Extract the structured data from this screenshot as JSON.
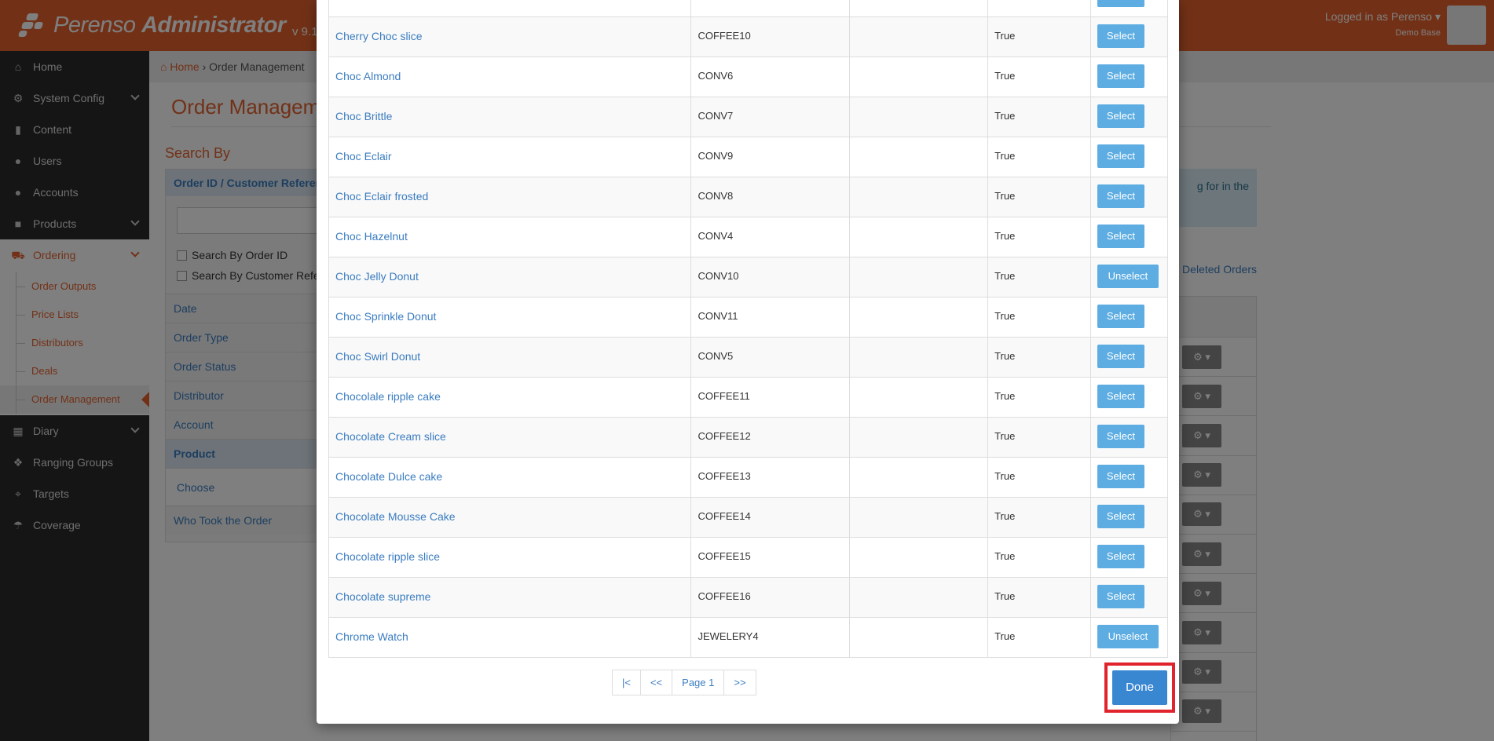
{
  "header": {
    "brand_light": "Perenso ",
    "brand_bold": "Administrator",
    "version": "v 9.1",
    "user": "Logged in as Perenso",
    "user_sub": "Demo Base"
  },
  "sidebar": {
    "items": [
      {
        "label": "Home",
        "icon": "home-icon"
      },
      {
        "label": "System Config",
        "icon": "gear-icon"
      },
      {
        "label": "Content",
        "icon": "file-icon"
      },
      {
        "label": "Users",
        "icon": "user-icon"
      },
      {
        "label": "Accounts",
        "icon": "group-icon"
      },
      {
        "label": "Products",
        "icon": "gift-icon"
      },
      {
        "label": "Ordering",
        "icon": "cart-icon"
      },
      {
        "label": "Diary",
        "icon": "calendar-icon"
      },
      {
        "label": "Ranging Groups",
        "icon": "cubes-icon"
      },
      {
        "label": "Targets",
        "icon": "crosshair-icon"
      },
      {
        "label": "Coverage",
        "icon": "umbrella-icon"
      }
    ],
    "ordering_sub": [
      "Order Outputs",
      "Price Lists",
      "Distributors",
      "Deals",
      "Order Management"
    ]
  },
  "main": {
    "breadcrumb_home": "Home",
    "breadcrumb_current": "Order Management",
    "title": "Order Manageme",
    "search_by": "Search By",
    "filter_header": "Order ID / Customer Referenc",
    "check_order_id": "Search By Order ID",
    "check_customer_ref": "Search By Customer Refe",
    "filters": [
      "Date",
      "Order Type",
      "Order Status",
      "Distributor",
      "Account",
      "Product"
    ],
    "choose": "Choose",
    "who_took": "Who Took the Order",
    "info_text": "g for in the",
    "deleted_link": "v Deleted Orders"
  },
  "modal": {
    "products": [
      {
        "name": "Cherry Choc slice",
        "code": "COFFEE10",
        "active": "True",
        "action": "Select"
      },
      {
        "name": "Choc Almond",
        "code": "CONV6",
        "active": "True",
        "action": "Select"
      },
      {
        "name": "Choc Brittle",
        "code": "CONV7",
        "active": "True",
        "action": "Select"
      },
      {
        "name": "Choc Eclair",
        "code": "CONV9",
        "active": "True",
        "action": "Select"
      },
      {
        "name": "Choc Eclair frosted",
        "code": "CONV8",
        "active": "True",
        "action": "Select"
      },
      {
        "name": "Choc Hazelnut",
        "code": "CONV4",
        "active": "True",
        "action": "Select"
      },
      {
        "name": "Choc Jelly Donut",
        "code": "CONV10",
        "active": "True",
        "action": "Unselect"
      },
      {
        "name": "Choc Sprinkle Donut",
        "code": "CONV11",
        "active": "True",
        "action": "Select"
      },
      {
        "name": "Choc Swirl Donut",
        "code": "CONV5",
        "active": "True",
        "action": "Select"
      },
      {
        "name": "Chocolale ripple cake",
        "code": "COFFEE11",
        "active": "True",
        "action": "Select"
      },
      {
        "name": "Chocolate Cream slice",
        "code": "COFFEE12",
        "active": "True",
        "action": "Select"
      },
      {
        "name": "Chocolate Dulce cake",
        "code": "COFFEE13",
        "active": "True",
        "action": "Select"
      },
      {
        "name": "Chocolate Mousse Cake",
        "code": "COFFEE14",
        "active": "True",
        "action": "Select"
      },
      {
        "name": "Chocolate ripple slice",
        "code": "COFFEE15",
        "active": "True",
        "action": "Select"
      },
      {
        "name": "Chocolate supreme",
        "code": "COFFEE16",
        "active": "True",
        "action": "Select"
      },
      {
        "name": "Chrome Watch",
        "code": "JEWELERY4",
        "active": "True",
        "action": "Unselect"
      }
    ],
    "top_partial_action": "Select",
    "pager": {
      "first": "|<",
      "prev": "<<",
      "current": "Page 1",
      "next": ">>"
    },
    "done_label": "Done"
  },
  "colors": {
    "brand": "#e4632f",
    "link": "#3a7cc0",
    "select": "#5dade2",
    "done": "#3a87d1",
    "highlight": "#e0232d"
  }
}
